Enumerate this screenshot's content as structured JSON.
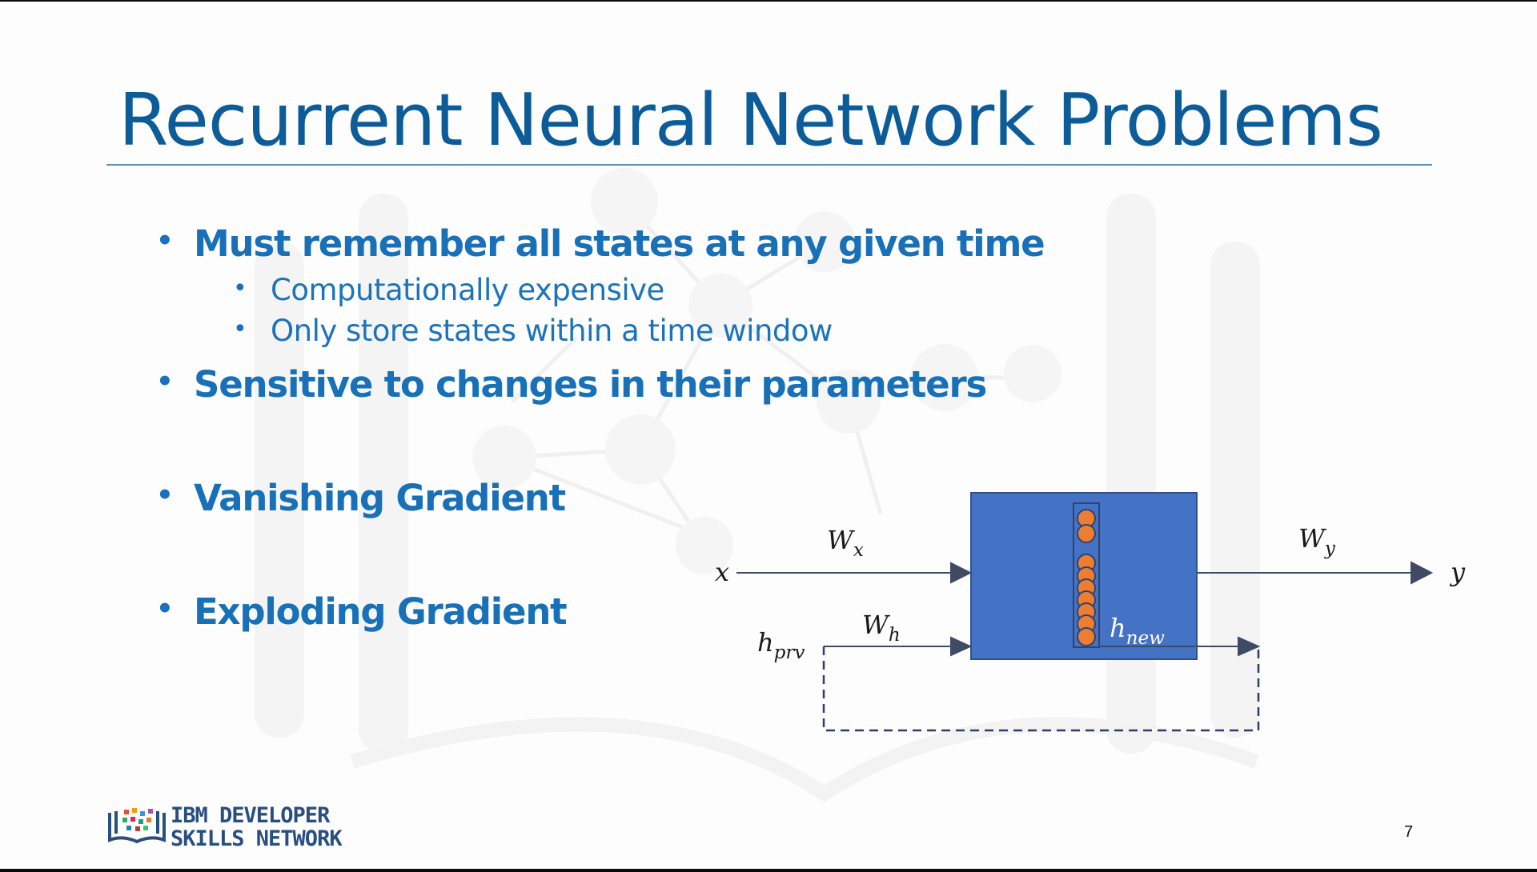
{
  "slide": {
    "title": "Recurrent Neural Network Problems",
    "bullets": [
      {
        "text": "Must remember all states at any given time",
        "sub": [
          "Computationally expensive",
          "Only store states within a time window"
        ]
      },
      {
        "text": "Sensitive to changes in their parameters"
      },
      {
        "text": "Vanishing Gradient"
      },
      {
        "text": "Exploding Gradient"
      }
    ],
    "page_number": "7"
  },
  "diagram": {
    "labels": {
      "x": "x",
      "y": "y",
      "w_x": {
        "base": "W",
        "sub": "x"
      },
      "w_y": {
        "base": "W",
        "sub": "y"
      },
      "w_h": {
        "base": "W",
        "sub": "h"
      },
      "h_prv": {
        "base": "h",
        "sub": "prv"
      },
      "h_new": {
        "base": "h",
        "sub": "new"
      }
    },
    "colors": {
      "cell": "#4472c4",
      "neuron": "#ed7d31",
      "arrow": "#3f4b64",
      "dashed": "#2e3d6c"
    }
  },
  "logo": {
    "line1": "IBM DEVELOPER",
    "line2": "SKILLS NETWORK"
  }
}
